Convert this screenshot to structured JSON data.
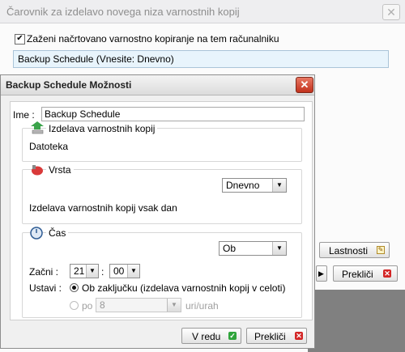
{
  "wizard": {
    "title": "Čarovnik za izdelavo novega niza varnostnih kopij",
    "close_glyph": "✕",
    "schedule_checkbox_label": "Zaženi načrtovano varnostno kopiranje na tem računalniku",
    "schedule_checked": true,
    "schedule_item": "Backup Schedule (Vnesite: Dnevno)",
    "lastnosti_label": "Lastnosti",
    "preklici_label": "Prekliči"
  },
  "dialog": {
    "title": "Backup Schedule Možnosti",
    "close_glyph": "✕",
    "name_label": "Ime :",
    "name_value": "Backup Schedule",
    "backup_group": {
      "label": "Izdelava varnostnih kopij",
      "value": "Datoteka"
    },
    "type_group": {
      "label": "Vrsta",
      "selected": "Dnevno",
      "description": "Izdelava varnostnih kopij vsak dan"
    },
    "time_group": {
      "label": "Čas",
      "mode_selected": "Ob",
      "start_label": "Začni :",
      "hour": "21",
      "separator": ":",
      "minute": "00",
      "stop_label": "Ustavi :",
      "stop_option_completion": "Ob zaključku (izdelava varnostnih kopij v celoti)",
      "stop_option_after_label": "po",
      "stop_option_after_value": "8",
      "stop_option_after_unit": "uri/urah"
    },
    "ok_label": "V redu",
    "cancel_label": "Prekliči"
  },
  "colors": {
    "ok_icon": "#2fa43b",
    "cancel_icon": "#d32626",
    "close_button": "#c2311c"
  }
}
